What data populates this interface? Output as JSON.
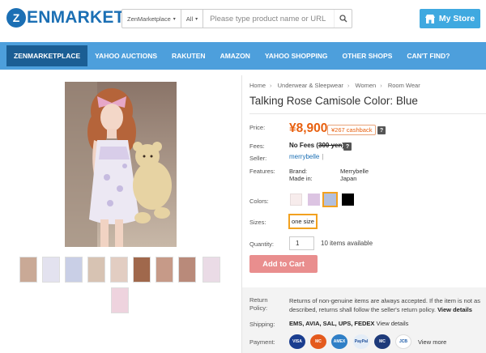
{
  "header": {
    "logo_mark": "Z",
    "logo_text": "ENMARKET",
    "search": {
      "scope": "ZenMarketplace",
      "category": "All",
      "placeholder": "Please type product name or URL"
    },
    "my_store_label": "My Store"
  },
  "nav": {
    "items": [
      "ZENMARKETPLACE",
      "YAHOO AUCTIONS",
      "RAKUTEN",
      "AMAZON",
      "YAHOO SHOPPING",
      "OTHER SHOPS",
      "CAN'T FIND?"
    ]
  },
  "breadcrumb": [
    "Home",
    "Underwear & Sleepwear",
    "Women",
    "Room Wear"
  ],
  "product": {
    "title": "Talking Rose Camisole Color: Blue",
    "price_label": "Price:",
    "price": "¥8,900",
    "cashback": "¥267 cashback",
    "fees_label": "Fees:",
    "fees_text": "No Fees (",
    "fees_strike": "300 yen",
    "fees_close": ")",
    "seller_label": "Seller:",
    "seller": "merrybelle",
    "seller_sep": "|",
    "features_label": "Features:",
    "features": [
      {
        "key": "Brand:",
        "value": "Merrybelle"
      },
      {
        "key": "Made in:",
        "value": "Japan"
      }
    ],
    "colors_label": "Colors:",
    "colors": [
      "#f7ecec",
      "#dcc4e2",
      "#b2bfde",
      "#000000"
    ],
    "selected_color_index": 2,
    "sizes_label": "Sizes:",
    "size": "one size",
    "quantity_label": "Quantity:",
    "quantity": "1",
    "stock": "10 items available",
    "add_to_cart": "Add to Cart"
  },
  "policy": {
    "return_label_1": "Return",
    "return_label_2": "Policy:",
    "return_text": "Returns of non-genuine items are always accepted. If the item is not as described, returns shall follow the seller's return policy.",
    "return_link": "View details",
    "shipping_label": "Shipping:",
    "shipping_methods": "EMS, AVIA, SAL, UPS, FEDEX",
    "shipping_link": "View details",
    "payment_label": "Payment:",
    "payments": [
      "VISA",
      "MC",
      "AMEX",
      "PayPal",
      "MC",
      "JCB"
    ],
    "view_more": "View more"
  },
  "help_badge": "?"
}
